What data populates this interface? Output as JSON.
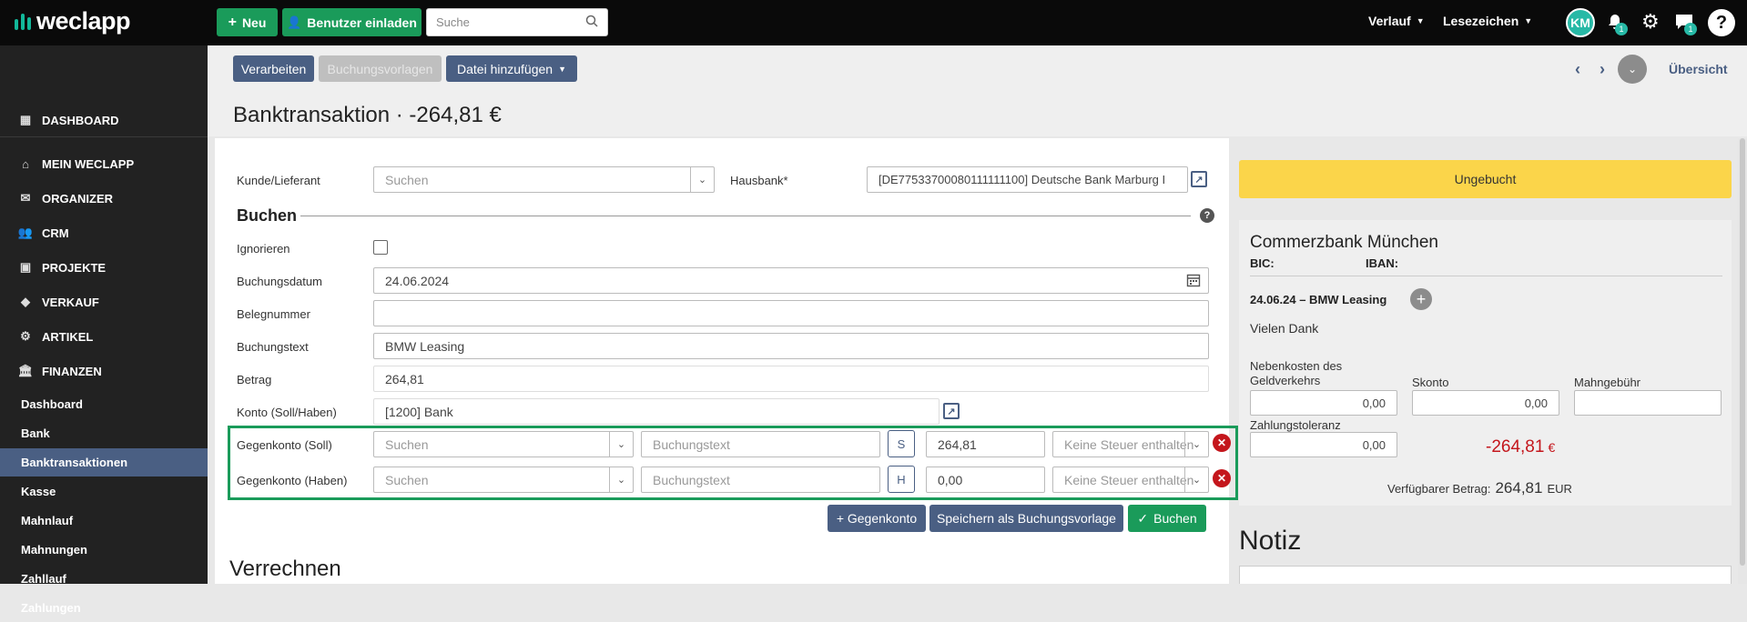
{
  "topbar": {
    "logo_text": "weclapp",
    "new_label": "Neu",
    "invite_label": "Benutzer einladen",
    "search_placeholder": "Suche",
    "history_label": "Verlauf",
    "bookmarks_label": "Lesezeichen",
    "avatar_initials": "KM",
    "notifications_count": "1",
    "messages_count": "1",
    "help_label": "?"
  },
  "sidebar": {
    "main_items": [
      {
        "label": "DASHBOARD",
        "icon": "dashboard-icon"
      },
      {
        "label": "MEIN WECLAPP",
        "icon": "home-icon"
      },
      {
        "label": "ORGANIZER",
        "icon": "mail-icon"
      },
      {
        "label": "CRM",
        "icon": "users-icon"
      },
      {
        "label": "PROJEKTE",
        "icon": "briefcase-icon"
      },
      {
        "label": "VERKAUF",
        "icon": "tag-icon"
      },
      {
        "label": "ARTIKEL",
        "icon": "gear-icon"
      },
      {
        "label": "FINANZEN",
        "icon": "bank-icon"
      }
    ],
    "sub_items": [
      "Dashboard",
      "Bank",
      "Banktransaktionen",
      "Kasse",
      "Mahnlauf",
      "Mahnungen",
      "Zahllauf",
      "Zahlungen"
    ],
    "active_sub": "Banktransaktionen"
  },
  "toolbar": {
    "process_label": "Verarbeiten",
    "templates_label": "Buchungsvorlagen",
    "add_file_label": "Datei hinzufügen",
    "overview_label": "Übersicht"
  },
  "page_title": "Banktransaktion · -264,81 €",
  "form": {
    "customer_label": "Kunde/Lieferant",
    "customer_placeholder": "Suchen",
    "hausbank_label": "Hausbank*",
    "hausbank_value": "[DE77533700080111111100] Deutsche Bank Marburg I",
    "section_title": "Buchen",
    "ignore_label": "Ignorieren",
    "date_label": "Buchungsdatum",
    "date_value": "24.06.2024",
    "voucher_label": "Belegnummer",
    "voucher_value": "",
    "text_label": "Buchungstext",
    "text_value": "BMW Leasing",
    "amount_label": "Betrag",
    "amount_value": "264,81",
    "account_label": "Konto (Soll/Haben)",
    "account_value": "[1200] Bank",
    "contra_debit_label": "Gegenkonto (Soll)",
    "contra_credit_label": "Gegenkonto (Haben)",
    "search_placeholder": "Suchen",
    "booking_text_placeholder": "Buchungstext",
    "debit_flag": "S",
    "credit_flag": "H",
    "debit_amount": "264,81",
    "credit_amount": "0,00",
    "tax_placeholder": "Keine Steuer enthalten",
    "add_contra_label": "+ Gegenkonto",
    "save_template_label": "Speichern als Buchungsvorlage",
    "book_label": "Buchen",
    "settle_title": "Verrechnen"
  },
  "right": {
    "status_label": "Ungebucht",
    "bank_name": "Commerzbank München",
    "bic_label": "BIC:",
    "iban_label": "IBAN:",
    "transaction_title": "24.06.24 – BMW Leasing",
    "transaction_note": "Vielen Dank",
    "fees_label_1": "Nebenkosten des",
    "fees_label_2": "Geldverkehrs",
    "fees_value": "0,00",
    "discount_label": "Skonto",
    "discount_value": "0,00",
    "dunning_label": "Mahngebühr",
    "dunning_value": "",
    "tolerance_label": "Zahlungstoleranz",
    "tolerance_value": "0,00",
    "total_value": "-264,81",
    "total_currency": "€",
    "available_label": "Verfügbarer Betrag:",
    "available_value": "264,81",
    "available_currency": "EUR",
    "note_title": "Notiz"
  },
  "colors": {
    "brand_green": "#1a9b5a",
    "nav_blue": "#4a5f83",
    "status_yellow": "#fbd54a",
    "negative_red": "#c4161c"
  }
}
